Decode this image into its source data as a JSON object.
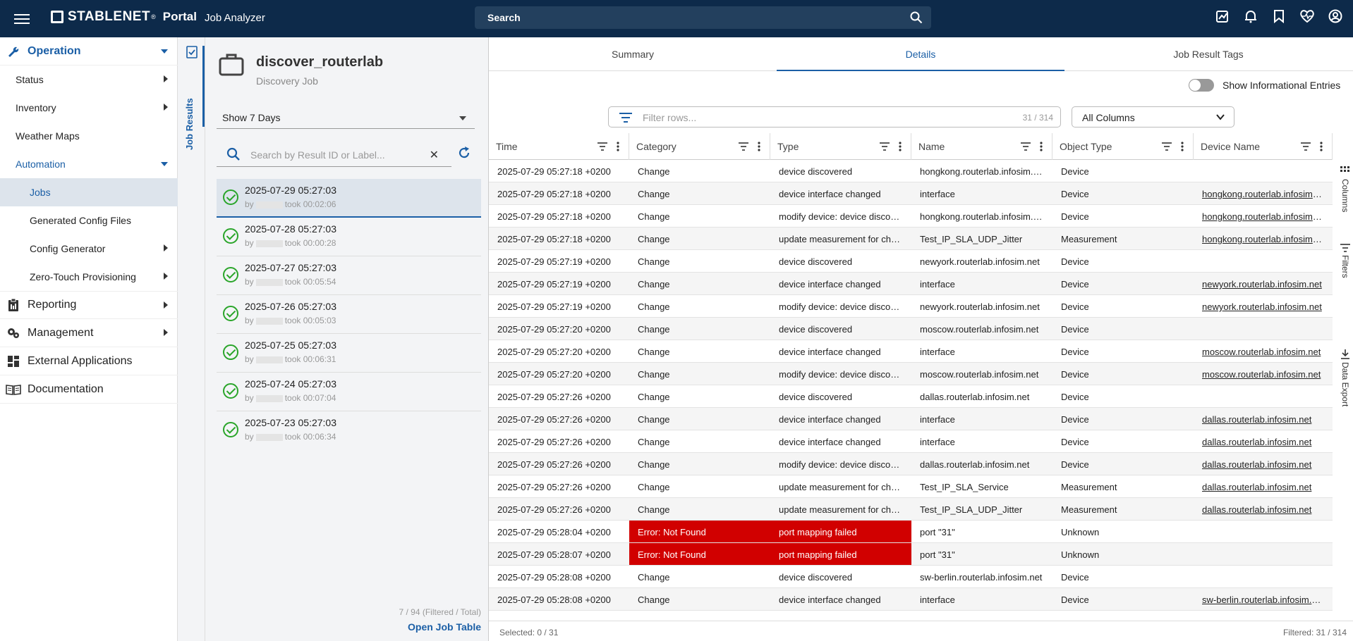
{
  "header": {
    "brand": "STABLENET",
    "reg": "®",
    "portal": "Portal",
    "app_name": "Job Analyzer",
    "search_label": "Search"
  },
  "nav": {
    "operation": "Operation",
    "status": "Status",
    "inventory": "Inventory",
    "weather_maps": "Weather Maps",
    "automation": "Automation",
    "jobs": "Jobs",
    "generated_config": "Generated Config Files",
    "config_generator": "Config Generator",
    "ztp": "Zero-Touch Provisioning",
    "reporting": "Reporting",
    "management": "Management",
    "external_apps": "External Applications",
    "documentation": "Documentation"
  },
  "sidetab": {
    "label": "Job Results"
  },
  "job": {
    "title": "discover_routerlab",
    "subtitle": "Discovery Job",
    "range": "Show 7 Days",
    "search_placeholder": "Search by Result ID or Label...",
    "results": [
      {
        "date": "2025-07-29 05:27:03",
        "by": "by",
        "took": "took 00:02:06"
      },
      {
        "date": "2025-07-28 05:27:03",
        "by": "by",
        "took": "took 00:00:28"
      },
      {
        "date": "2025-07-27 05:27:03",
        "by": "by",
        "took": "took 00:05:54"
      },
      {
        "date": "2025-07-26 05:27:03",
        "by": "by",
        "took": "took 00:05:03"
      },
      {
        "date": "2025-07-25 05:27:03",
        "by": "by",
        "took": "took 00:06:31"
      },
      {
        "date": "2025-07-24 05:27:03",
        "by": "by",
        "took": "took 00:07:04"
      },
      {
        "date": "2025-07-23 05:27:03",
        "by": "by",
        "took": "took 00:06:34"
      }
    ],
    "count": "7 / 94 (Filtered / Total)",
    "open_table": "Open Job Table"
  },
  "tabs": {
    "summary": "Summary",
    "details": "Details",
    "tags": "Job Result Tags"
  },
  "details": {
    "toggle_label": "Show Informational Entries",
    "filter_placeholder": "Filter rows...",
    "filter_count": "31 / 314",
    "column_select": "All Columns",
    "columns": [
      "Time",
      "Category",
      "Type",
      "Name",
      "Object Type",
      "Device Name"
    ],
    "rows": [
      [
        "2025-07-29 05:27:18 +0200",
        "Change",
        "device discovered",
        "hongkong.routerlab.infosim.net",
        "Device",
        ""
      ],
      [
        "2025-07-29 05:27:18 +0200",
        "Change",
        "device interface changed",
        "interface",
        "Device",
        "hongkong.routerlab.infosim.net"
      ],
      [
        "2025-07-29 05:27:18 +0200",
        "Change",
        "modify device: device discovered",
        "hongkong.routerlab.infosim.net",
        "Device",
        "hongkong.routerlab.infosim.net"
      ],
      [
        "2025-07-29 05:27:18 +0200",
        "Change",
        "update measurement for changed",
        "Test_IP_SLA_UDP_Jitter",
        "Measurement",
        "hongkong.routerlab.infosim.net"
      ],
      [
        "2025-07-29 05:27:19 +0200",
        "Change",
        "device discovered",
        "newyork.routerlab.infosim.net",
        "Device",
        ""
      ],
      [
        "2025-07-29 05:27:19 +0200",
        "Change",
        "device interface changed",
        "interface",
        "Device",
        "newyork.routerlab.infosim.net"
      ],
      [
        "2025-07-29 05:27:19 +0200",
        "Change",
        "modify device: device discovered",
        "newyork.routerlab.infosim.net",
        "Device",
        "newyork.routerlab.infosim.net"
      ],
      [
        "2025-07-29 05:27:20 +0200",
        "Change",
        "device discovered",
        "moscow.routerlab.infosim.net",
        "Device",
        ""
      ],
      [
        "2025-07-29 05:27:20 +0200",
        "Change",
        "device interface changed",
        "interface",
        "Device",
        "moscow.routerlab.infosim.net"
      ],
      [
        "2025-07-29 05:27:20 +0200",
        "Change",
        "modify device: device discovered",
        "moscow.routerlab.infosim.net",
        "Device",
        "moscow.routerlab.infosim.net"
      ],
      [
        "2025-07-29 05:27:26 +0200",
        "Change",
        "device discovered",
        "dallas.routerlab.infosim.net",
        "Device",
        ""
      ],
      [
        "2025-07-29 05:27:26 +0200",
        "Change",
        "device interface changed",
        "interface",
        "Device",
        "dallas.routerlab.infosim.net"
      ],
      [
        "2025-07-29 05:27:26 +0200",
        "Change",
        "device interface changed",
        "interface",
        "Device",
        "dallas.routerlab.infosim.net"
      ],
      [
        "2025-07-29 05:27:26 +0200",
        "Change",
        "modify device: device discovered",
        "dallas.routerlab.infosim.net",
        "Device",
        "dallas.routerlab.infosim.net"
      ],
      [
        "2025-07-29 05:27:26 +0200",
        "Change",
        "update measurement for changed",
        "Test_IP_SLA_Service",
        "Measurement",
        "dallas.routerlab.infosim.net"
      ],
      [
        "2025-07-29 05:27:26 +0200",
        "Change",
        "update measurement for changed",
        "Test_IP_SLA_UDP_Jitter",
        "Measurement",
        "dallas.routerlab.infosim.net"
      ],
      [
        "2025-07-29 05:28:04 +0200",
        "Error: Not Found",
        "port mapping failed",
        "port \"31\"",
        "Unknown",
        ""
      ],
      [
        "2025-07-29 05:28:07 +0200",
        "Error: Not Found",
        "port mapping failed",
        "port \"31\"",
        "Unknown",
        ""
      ],
      [
        "2025-07-29 05:28:08 +0200",
        "Change",
        "device discovered",
        "sw-berlin.routerlab.infosim.net",
        "Device",
        ""
      ],
      [
        "2025-07-29 05:28:08 +0200",
        "Change",
        "device interface changed",
        "interface",
        "Device",
        "sw-berlin.routerlab.infosim.net"
      ]
    ],
    "rail": [
      "Columns",
      "Filters",
      "Data Export"
    ],
    "selected": "Selected: 0 / 31",
    "filtered": "Filtered: 31 / 314"
  },
  "colors": {
    "header": "#0d2a4a",
    "accent": "#1b5fa6",
    "error": "#d10000",
    "success": "#2aa52a"
  }
}
